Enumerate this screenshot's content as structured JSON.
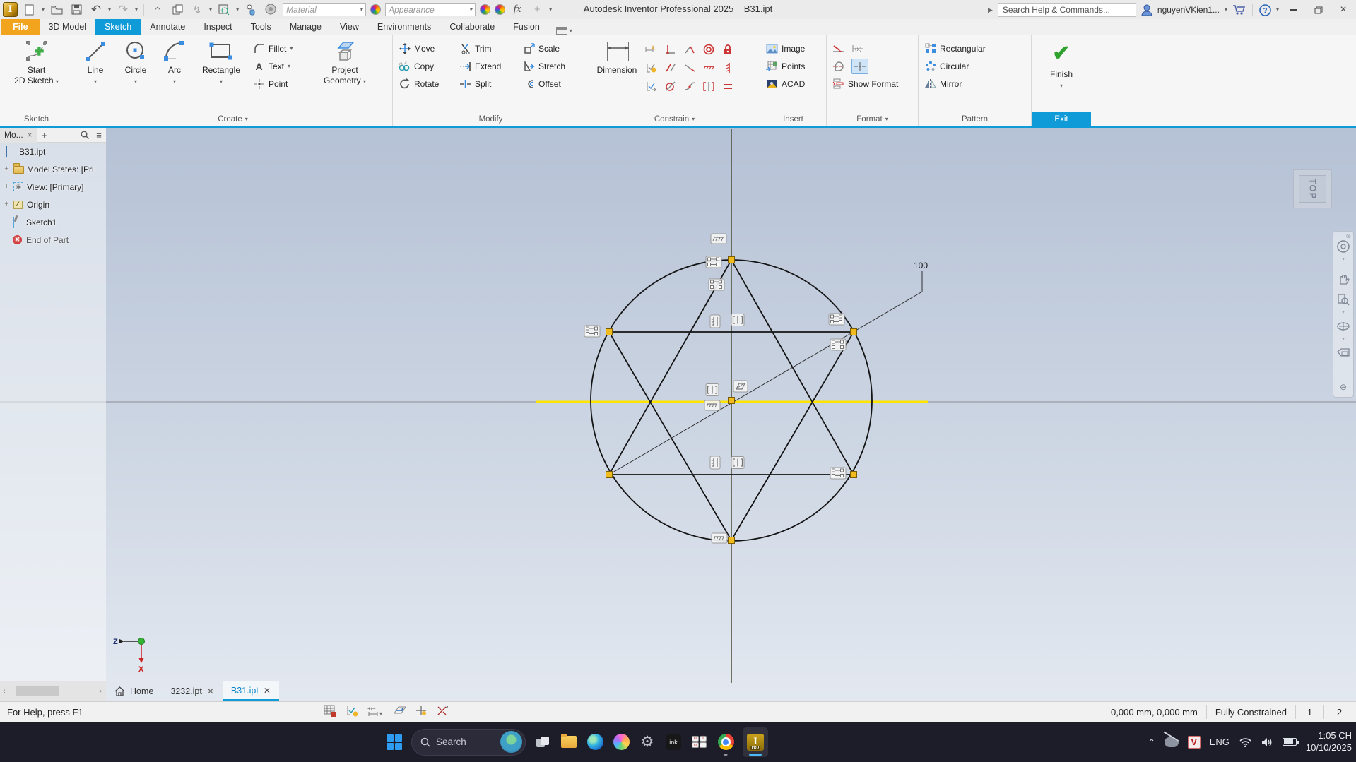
{
  "titlebar": {
    "title": "Autodesk Inventor Professional 2025",
    "document": "B31.ipt",
    "material_label": "Material",
    "appearance_label": "Appearance",
    "search_placeholder": "Search Help & Commands...",
    "user": "nguyenVKien1..."
  },
  "tabs": {
    "items": [
      "File",
      "3D Model",
      "Sketch",
      "Annotate",
      "Inspect",
      "Tools",
      "Manage",
      "View",
      "Environments",
      "Collaborate",
      "Fusion"
    ]
  },
  "ribbon": {
    "panels": {
      "sketch": {
        "label": "Sketch",
        "start_line1": "Start",
        "start_line2": "2D Sketch"
      },
      "create": {
        "label": "Create",
        "line": "Line",
        "circle": "Circle",
        "arc": "Arc",
        "rectangle": "Rectangle",
        "fillet": "Fillet",
        "text": "Text",
        "point": "Point",
        "project_line1": "Project",
        "project_line2": "Geometry"
      },
      "modify": {
        "label": "Modify",
        "move": "Move",
        "copy": "Copy",
        "rotate": "Rotate",
        "trim": "Trim",
        "extend": "Extend",
        "split": "Split",
        "scale": "Scale",
        "stretch": "Stretch",
        "offset": "Offset"
      },
      "constrain": {
        "label": "Constrain",
        "dimension": "Dimension",
        "glyphs": [
          "automatic-dimension",
          "perpendicular",
          "coincident",
          "concentric",
          "fix-lock",
          "constraint-settings",
          "parallel",
          "collinear",
          "horizontal",
          "vertical",
          "show-constraints",
          "tangent",
          "smooth",
          "symmetric",
          "equal"
        ]
      },
      "insert": {
        "label": "Insert",
        "image": "Image",
        "points": "Points",
        "acad": "ACAD"
      },
      "format": {
        "label": "Format",
        "show_format": "Show Format"
      },
      "pattern": {
        "label": "Pattern",
        "rectangular": "Rectangular",
        "circular": "Circular",
        "mirror": "Mirror"
      },
      "exit": {
        "label": "Exit",
        "finish": "Finish"
      }
    }
  },
  "browser": {
    "tab": "Mo...",
    "items": [
      {
        "label": "B31.ipt",
        "icon": "part-cube-icon"
      },
      {
        "label": "Model States: [Pri",
        "icon": "folder-icon"
      },
      {
        "label": "View: [Primary]",
        "icon": "view-eye-icon"
      },
      {
        "label": "Origin",
        "icon": "origin-axes-icon"
      },
      {
        "label": "Sketch1",
        "icon": "sketch-icon"
      },
      {
        "label": "End of Part",
        "icon": "end-of-part-icon"
      }
    ]
  },
  "canvas": {
    "dimension": "100",
    "viewcube": "TOP",
    "axis_z": "Z",
    "axis_x": "X"
  },
  "doc_tabs": {
    "home": "Home",
    "prev": "3232.ipt",
    "active": "B31.ipt"
  },
  "statusbar": {
    "help": "For Help, press F1",
    "coords": "0,000 mm, 0,000 mm",
    "state": "Fully Constrained",
    "num1": "1",
    "num2": "2"
  },
  "taskbar": {
    "search": "Search",
    "lang": "ENG",
    "ime": "V",
    "time": "1:05 CH",
    "date": "10/10/2025"
  },
  "icons": {
    "chevron-down": "▾",
    "close": "×",
    "plus": "+",
    "search": "magnifier",
    "home": "⌂",
    "undo": "↶",
    "redo": "↷",
    "menu": "≡",
    "minus": "⊖"
  }
}
